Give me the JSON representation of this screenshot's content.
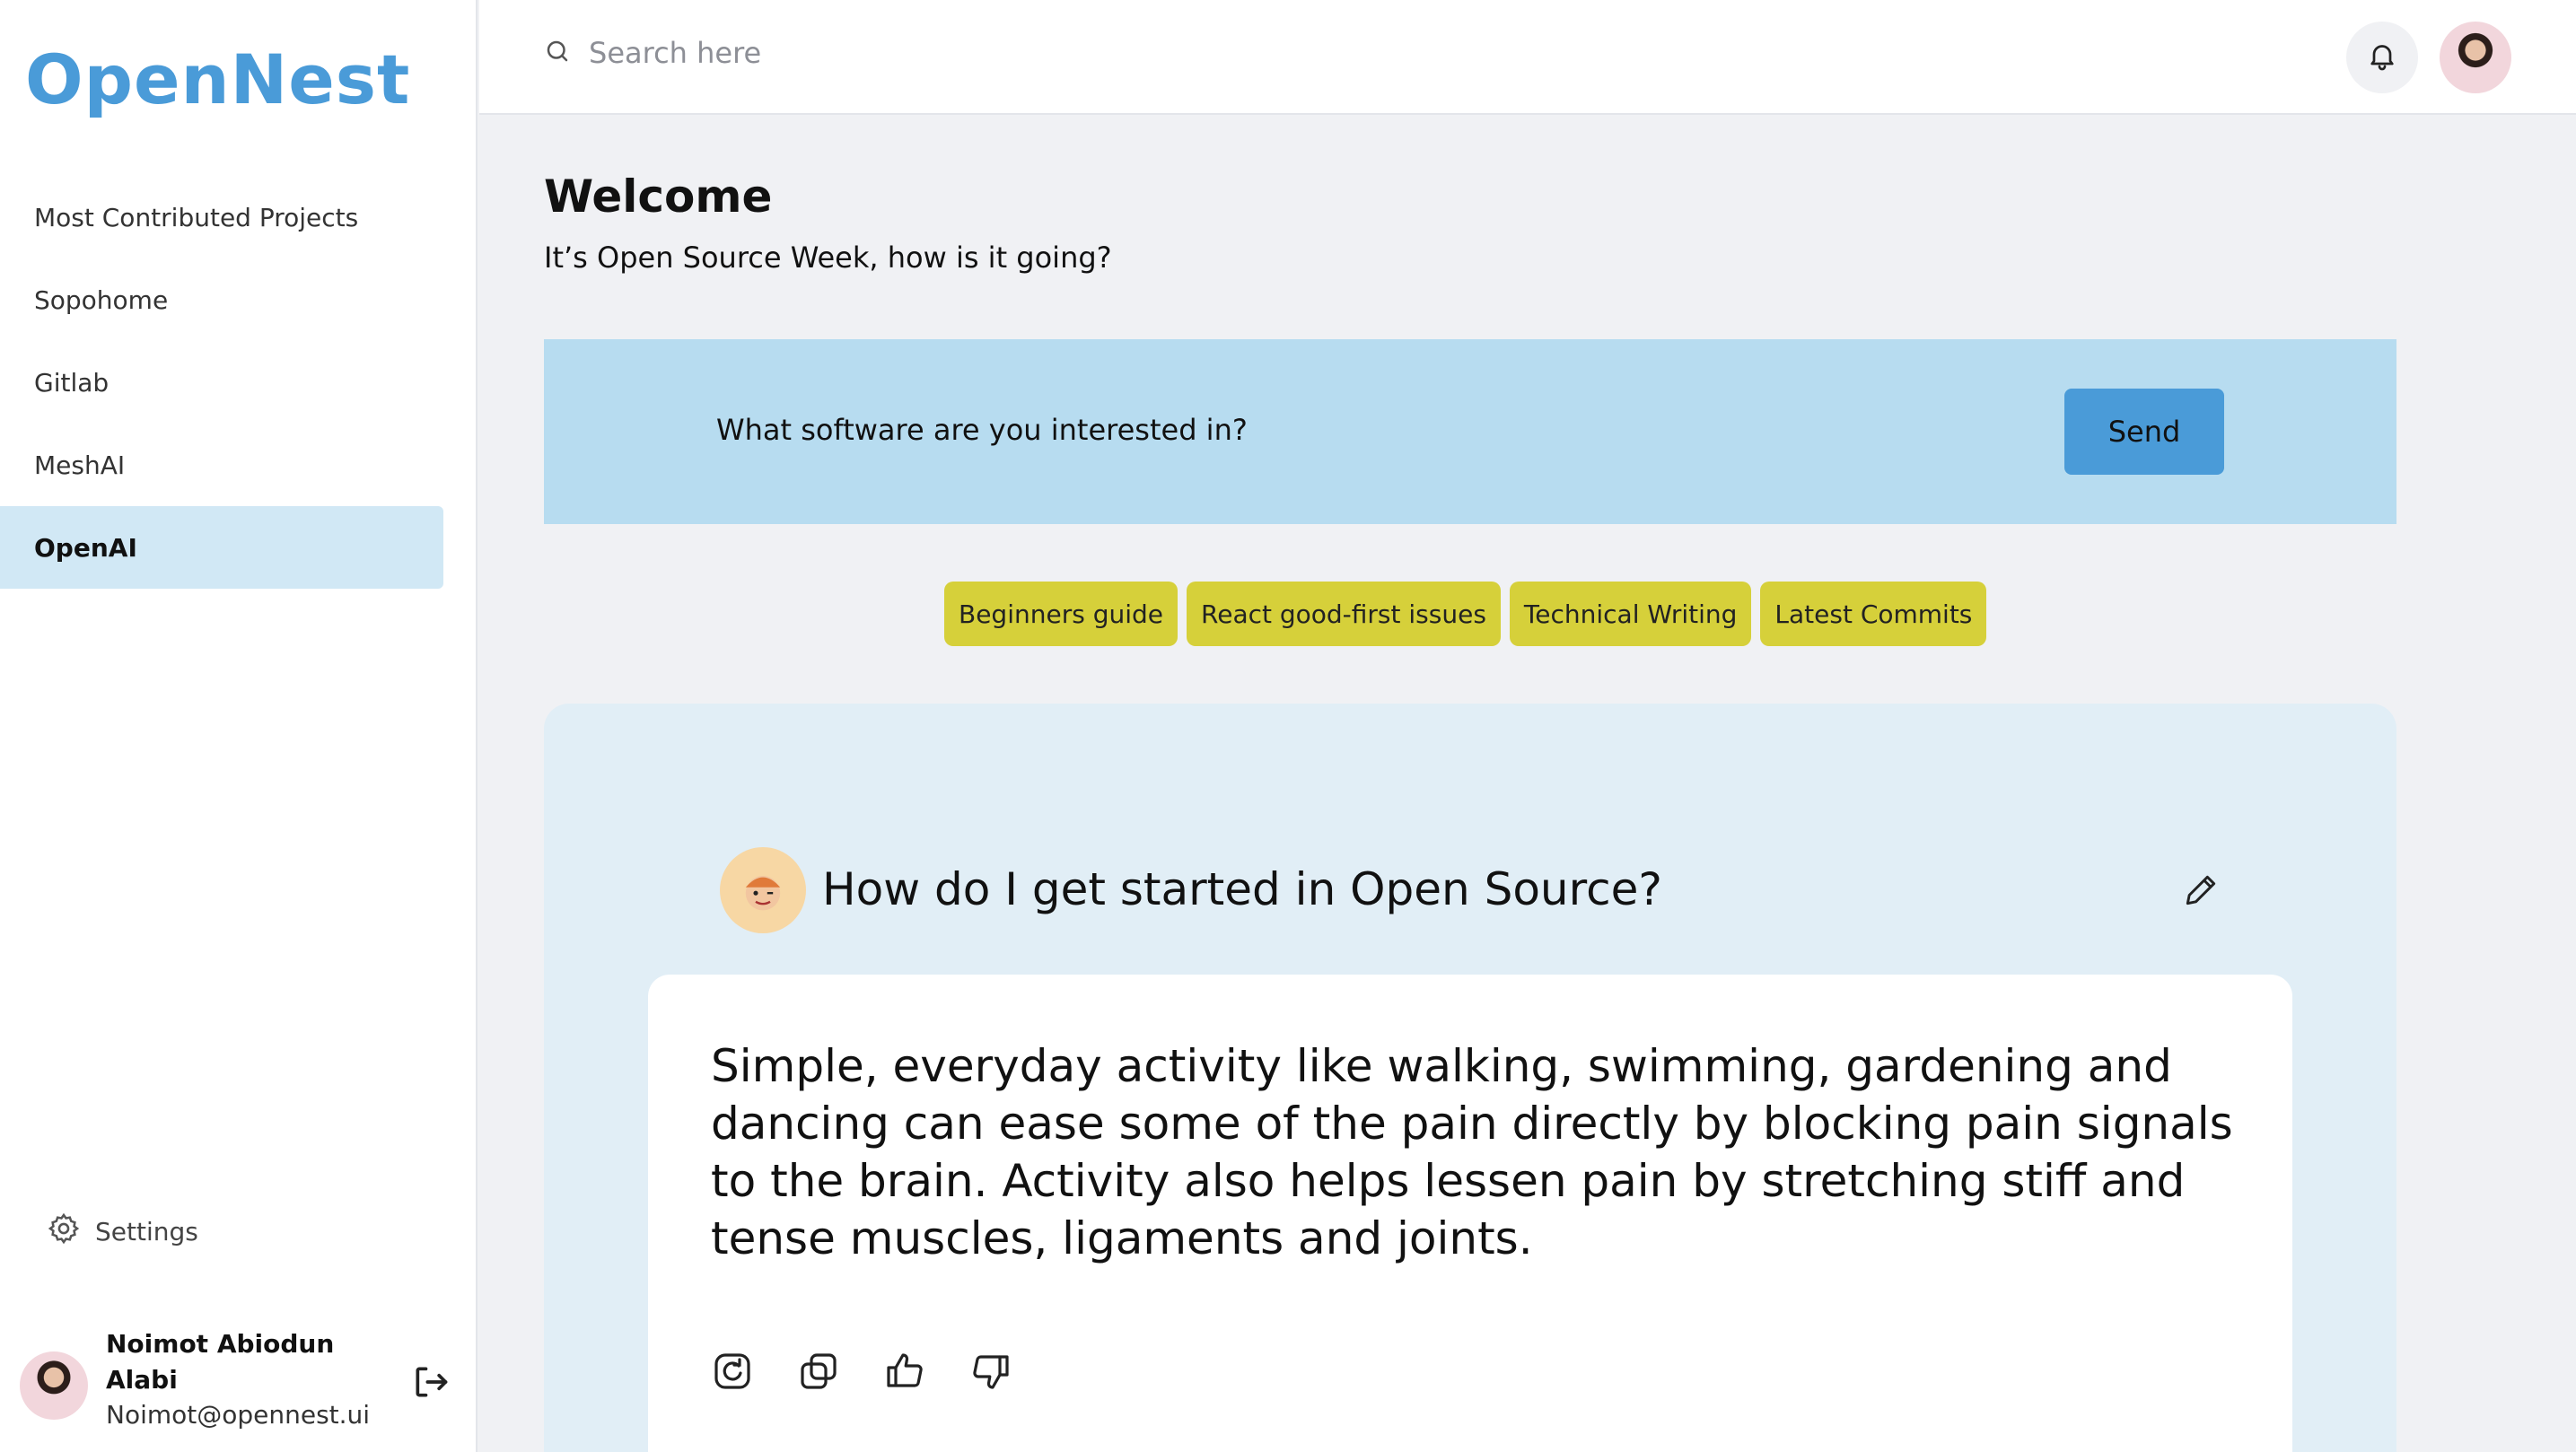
{
  "app": {
    "logo": "OpenNest"
  },
  "sidebar": {
    "items": [
      {
        "label": "Most Contributed Projects"
      },
      {
        "label": "Sopohome"
      },
      {
        "label": "Gitlab"
      },
      {
        "label": "MeshAI"
      },
      {
        "label": "OpenAI",
        "active": true
      }
    ],
    "settings_label": "Settings",
    "user": {
      "name": "Noimot Abiodun Alabi",
      "email": "Noimot@opennest.ui"
    }
  },
  "header": {
    "search_placeholder": "Search here"
  },
  "main": {
    "welcome_title": "Welcome",
    "welcome_subtitle": "It’s Open Source Week, how is it going?",
    "prompt_text": "What software are you interested in?",
    "send_label": "Send",
    "chips": [
      "Beginners guide",
      "React good-first issues",
      "Technical Writing",
      "Latest Commits"
    ],
    "chat": {
      "question": "How do I get started in Open Source?",
      "answer": "Simple, everyday activity like walking, swimming, gardening and dancing can ease some of the pain directly by blocking pain signals to the brain. Activity also helps lessen pain by stretching stiff and tense muscles, ligaments and joints."
    }
  },
  "colors": {
    "accent": "#4a9bd8",
    "prompt_bg": "#b7dcf0",
    "chip_bg": "#d6d03a",
    "active_nav_bg": "#d1e8f5",
    "chat_bg": "#e1eef6"
  },
  "icons": {
    "search": "search-icon",
    "bell": "bell-icon",
    "settings": "gear-icon",
    "logout": "logout-icon",
    "edit": "pencil-icon",
    "actions": [
      "regenerate-icon",
      "copy-icon",
      "thumbs-up-icon",
      "thumbs-down-icon"
    ]
  }
}
